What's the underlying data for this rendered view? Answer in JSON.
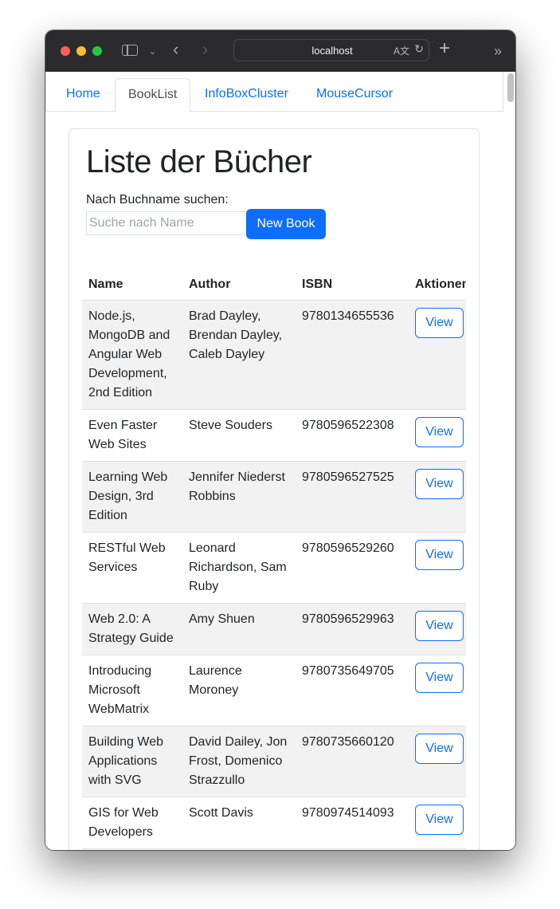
{
  "browser": {
    "url": "localhost"
  },
  "nav": {
    "tabs": [
      {
        "label": "Home"
      },
      {
        "label": "BookList"
      },
      {
        "label": "InfoBoxCluster"
      },
      {
        "label": "MouseCursor"
      }
    ]
  },
  "page": {
    "title": "Liste der Bücher",
    "search_label": "Nach Buchname suchen:",
    "search_placeholder": "Suche nach Name",
    "new_book_label": "New Book"
  },
  "table": {
    "headers": [
      "Name",
      "Author",
      "ISBN",
      "Aktionen"
    ],
    "view_label": "View",
    "rows": [
      {
        "name": "Node.js, MongoDB and Angular Web Development, 2nd Edition",
        "author": "Brad Dayley, Brendan Dayley, Caleb Dayley",
        "isbn": "9780134655536"
      },
      {
        "name": "Even Faster Web Sites",
        "author": "Steve Souders",
        "isbn": "9780596522308"
      },
      {
        "name": "Learning Web Design, 3rd Edition",
        "author": "Jennifer Niederst Robbins",
        "isbn": "9780596527525"
      },
      {
        "name": "RESTful Web Services",
        "author": "Leonard Richardson, Sam Ruby",
        "isbn": "9780596529260"
      },
      {
        "name": "Web 2.0: A Strategy Guide",
        "author": "Amy Shuen",
        "isbn": "9780596529963"
      },
      {
        "name": "Introducing Microsoft WebMatrix",
        "author": "Laurence Moroney",
        "isbn": "9780735649705"
      },
      {
        "name": "Building Web Applications with SVG",
        "author": "David Dailey, Jon Frost, Domenico Strazzullo",
        "isbn": "9780735660120"
      },
      {
        "name": "GIS for Web Developers",
        "author": "Scott Davis",
        "isbn": "9780974514093"
      }
    ]
  }
}
